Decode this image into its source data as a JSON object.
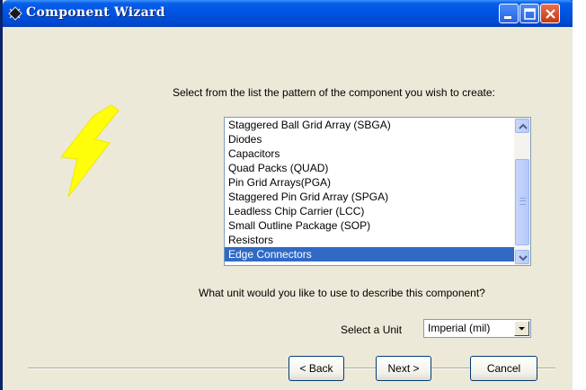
{
  "window": {
    "title": "Component Wizard",
    "title_icon": "component-wizard-icon",
    "controls": [
      "minimize-icon",
      "maximize-icon",
      "close-icon"
    ]
  },
  "colors": {
    "titlebar": "#0055e5",
    "selection": "#316ac5",
    "bolt": "#ffff00",
    "dialog_bg": "#ece9d8"
  },
  "main": {
    "graphic": "lightning-bolt-icon",
    "list_prompt": "Select from the list the pattern of the component you wish to create:",
    "patterns": [
      "Staggered Ball Grid Array (SBGA)",
      "Diodes",
      "Capacitors",
      "Quad Packs (QUAD)",
      "Pin Grid Arrays(PGA)",
      "Staggered Pin Grid Array (SPGA)",
      "Leadless Chip Carrier (LCC)",
      "Small Outline Package (SOP)",
      "Resistors",
      "Edge Connectors"
    ],
    "selected_pattern": "Edge Connectors",
    "unit_prompt": "What unit would you like to use to describe this component?",
    "unit_label": "Select a Unit",
    "unit_value": "Imperial (mil)"
  },
  "buttons": {
    "back": "< Back",
    "next": "Next >",
    "cancel": "Cancel"
  }
}
